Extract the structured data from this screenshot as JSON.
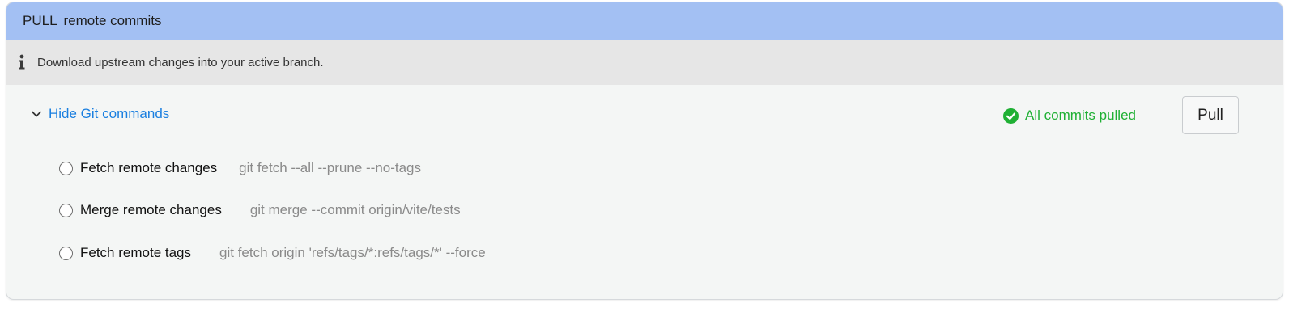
{
  "header": {
    "prefix": "PULL",
    "title": "remote commits"
  },
  "info": {
    "icon": "info-icon",
    "text": "Download upstream changes into your active branch."
  },
  "toggle": {
    "icon": "chevron-down-icon",
    "label": "Hide Git commands"
  },
  "status": {
    "icon": "check-circle-icon",
    "text": "All commits pulled",
    "color": "#1fb034"
  },
  "pull_button": {
    "label": "Pull"
  },
  "steps": [
    {
      "label": "Fetch remote changes",
      "command": "git fetch --all --prune --no-tags"
    },
    {
      "label": "Merge remote changes",
      "command": "git merge --commit origin/vite/tests"
    },
    {
      "label": "Fetch remote tags",
      "command": "git fetch origin 'refs/tags/*:refs/tags/*' --force"
    }
  ],
  "colors": {
    "header_bg": "#a3c0f3",
    "info_bg": "#e6e6e6",
    "panel_bg": "#f4f6f5",
    "link": "#1a7fe0",
    "command_text": "#8a8a8a"
  }
}
